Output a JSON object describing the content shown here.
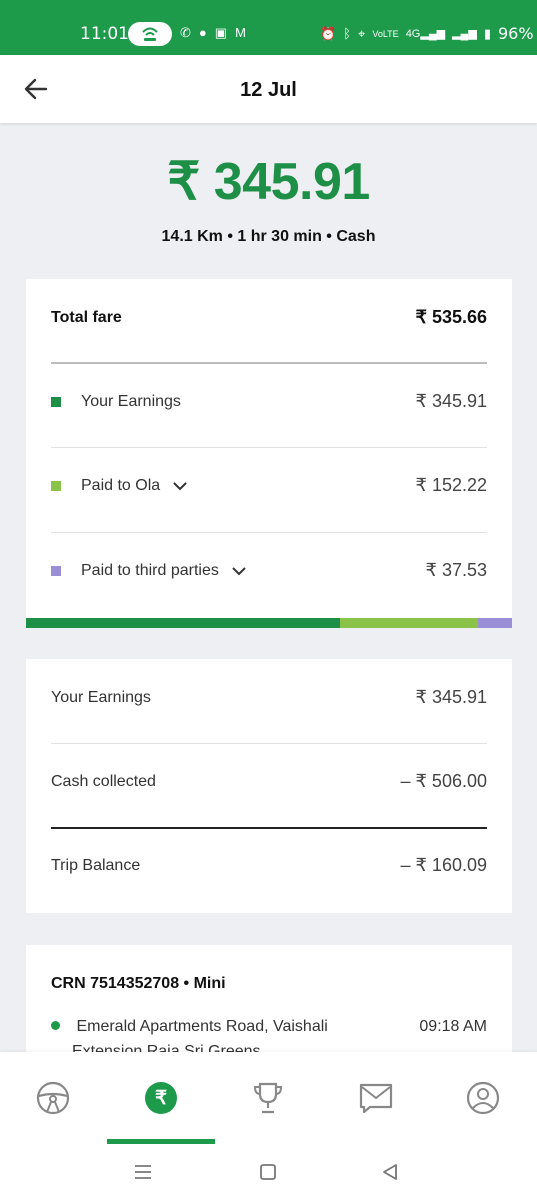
{
  "status_bar": {
    "time": "11:01",
    "battery": "96%",
    "network": "4G"
  },
  "header": {
    "title": "12 Jul"
  },
  "trip": {
    "earnings_amount": "₹ 345.91",
    "summary": "14.1 Km • 1 hr 30 min • Cash"
  },
  "fare_card": {
    "total_label": "Total fare",
    "total_value": "₹ 535.66",
    "rows": [
      {
        "label": "Your Earnings",
        "value": "₹ 345.91",
        "color": "#1e8f46"
      },
      {
        "label": "Paid to Ola",
        "value": "₹ 152.22",
        "color": "#8bc34a"
      },
      {
        "label": "Paid to third parties",
        "value": "₹ 37.53",
        "color": "#9a8fd6"
      }
    ]
  },
  "balance_card": {
    "earnings_label": "Your Earnings",
    "earnings_value": "₹ 345.91",
    "cash_label": "Cash collected",
    "cash_value": "– ₹ 506.00",
    "balance_label": "Trip Balance",
    "balance_value": "– ₹ 160.09"
  },
  "ride_card": {
    "crn": "CRN 7514352708 • Mini",
    "pickup_line1": "Emerald Apartments Road, Vaishali",
    "pickup_line2": "Extension Raja Sri Greens",
    "pickup_time": "09:18 AM"
  },
  "bottom_nav": {
    "items": [
      "steering-wheel-icon",
      "rupee-icon",
      "trophy-icon",
      "mail-icon",
      "profile-icon"
    ],
    "active": "rupee-icon"
  },
  "colors": {
    "brand": "#1e9a4b",
    "earnings": "#1e8f46",
    "ola": "#8bc34a",
    "third_party": "#9a8fd6"
  }
}
